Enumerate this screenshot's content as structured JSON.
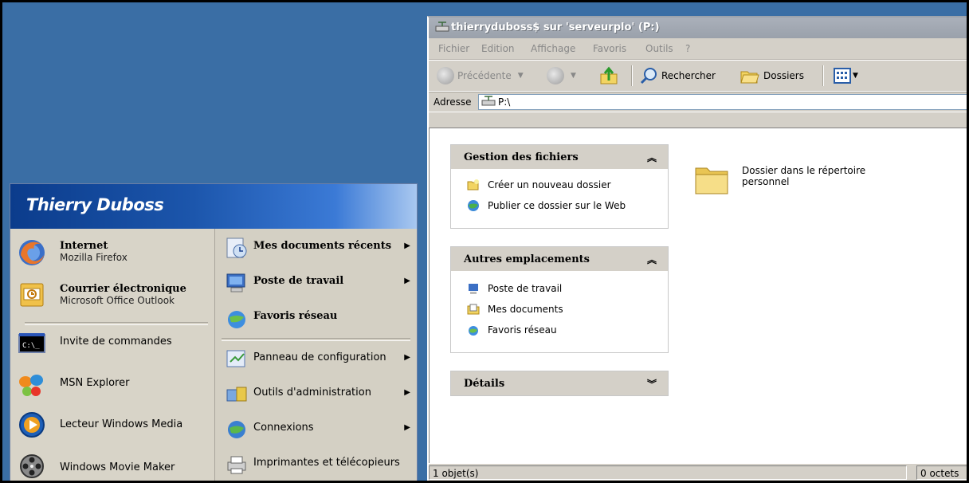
{
  "start_menu": {
    "user_name": "Thierry Duboss",
    "pinned": [
      {
        "title": "Internet",
        "subtitle": "Mozilla Firefox",
        "icon": "firefox-icon"
      },
      {
        "title": "Courrier électronique",
        "subtitle": "Microsoft Office Outlook",
        "icon": "outlook-icon"
      }
    ],
    "recent": [
      {
        "label": "Invite de commandes",
        "icon": "command-prompt-icon"
      },
      {
        "label": "MSN Explorer",
        "icon": "msn-butterfly-icon"
      },
      {
        "label": "Lecteur Windows Media",
        "icon": "media-player-icon"
      },
      {
        "label": "Windows Movie Maker",
        "icon": "movie-maker-icon"
      }
    ],
    "right": [
      {
        "label": "Mes documents récents",
        "bold": true,
        "arrow": "▶",
        "icon": "recent-docs-icon"
      },
      {
        "label": "Poste de travail",
        "bold": true,
        "arrow": "▶",
        "icon": "my-computer-icon"
      },
      {
        "label": "Favoris réseau",
        "bold": true,
        "icon": "network-icon"
      },
      {
        "label": "Panneau de configuration",
        "bold": false,
        "arrow": "▶",
        "icon": "control-panel-icon"
      },
      {
        "label": "Outils d'administration",
        "bold": false,
        "arrow": "▶",
        "icon": "admin-tools-icon"
      },
      {
        "label": "Connexions",
        "bold": false,
        "arrow": "▶",
        "icon": "connections-icon"
      },
      {
        "label": "Imprimantes et télécopieurs",
        "bold": false,
        "icon": "printer-icon"
      }
    ]
  },
  "explorer": {
    "title": "thierryduboss$ sur 'serveurplo' (P:)",
    "menu": [
      "Fichier",
      "Edition",
      "Affichage",
      "Favoris",
      "Outils",
      "?"
    ],
    "toolbar": {
      "back_label": "Précédente",
      "search_label": "Rechercher",
      "folders_label": "Dossiers"
    },
    "address": {
      "label": "Adresse",
      "value": "P:\\"
    },
    "panels": {
      "file_tasks": {
        "title": "Gestion des fichiers",
        "chevron": "︽",
        "items": [
          "Créer un nouveau dossier",
          "Publier ce dossier sur le Web"
        ]
      },
      "other_places": {
        "title": "Autres emplacements",
        "chevron": "︽",
        "items": [
          "Poste de travail",
          "Mes documents",
          "Favoris réseau"
        ]
      },
      "details": {
        "title": "Détails",
        "chevron": "︾"
      }
    },
    "files": [
      {
        "name": "Dossier dans le répertoire personnel",
        "icon": "folder-icon"
      }
    ],
    "status": {
      "objects": "1 objet(s)",
      "size": "0 octets"
    }
  },
  "colors": {
    "desktop": "#3a6ea5",
    "start_header": "#1c56ac",
    "title_inactive": "#9aa1ab"
  }
}
